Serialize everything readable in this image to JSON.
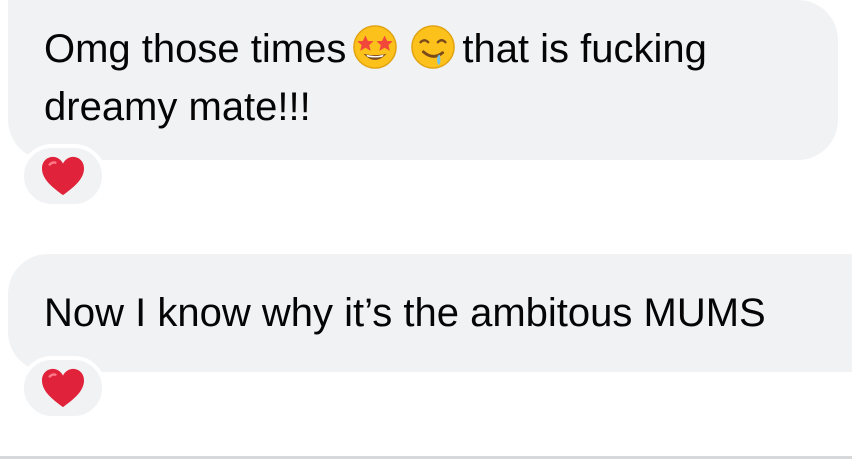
{
  "messages": [
    {
      "line1_before": "Omg those times",
      "emoji_1": "star-struck-emoji",
      "emoji_2": "drooling-face-emoji",
      "line1_after": "that is fucking",
      "line2": "dreamy mate!!!",
      "reaction": "heart-reaction-icon"
    },
    {
      "text": "Now I know why it’s the ambitous MUMS",
      "reaction": "heart-reaction-icon"
    }
  ],
  "colors": {
    "bubble": "#f1f2f4",
    "text": "#050505",
    "heart": "#e0233a"
  }
}
